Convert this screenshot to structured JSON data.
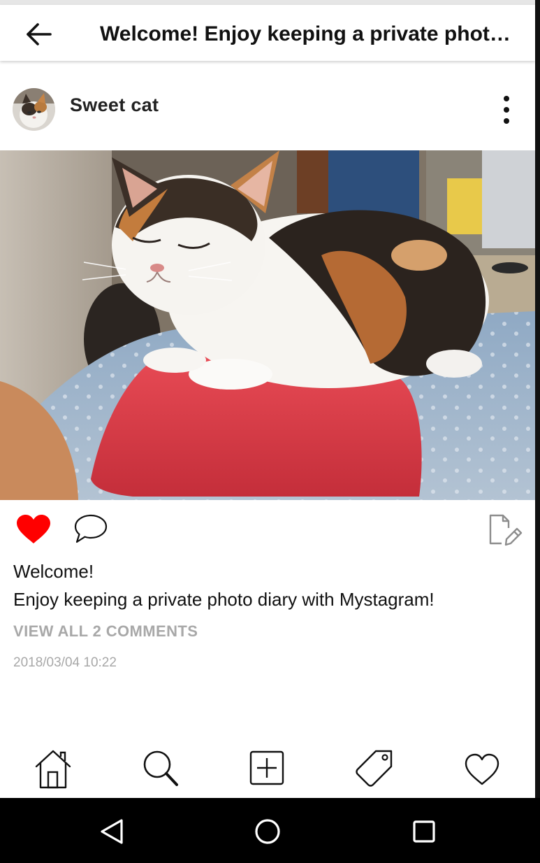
{
  "app": {
    "title": "Welcome! Enjoy keeping a private photo diary with Mystagram!"
  },
  "post": {
    "username": "Sweet cat",
    "caption_line1": "Welcome!",
    "caption_line2": "Enjoy keeping a private photo diary with Mystagram!",
    "view_comments": "VIEW ALL 2 COMMENTS",
    "timestamp": "2018/03/04 10:22",
    "liked": true
  },
  "icons": {
    "back": "arrow-left-icon",
    "more": "more-vertical-icon",
    "like": "heart-filled-icon",
    "comment": "speech-bubble-icon",
    "edit": "edit-document-icon",
    "nav": [
      "home-icon",
      "search-icon",
      "add-box-icon",
      "tag-icon",
      "heart-outline-icon"
    ],
    "system": [
      "back-triangle-icon",
      "home-circle-icon",
      "recents-square-icon"
    ]
  },
  "colors": {
    "like": "#ff0000",
    "muted_text": "#a8a8a8",
    "system_nav": "#000000"
  }
}
